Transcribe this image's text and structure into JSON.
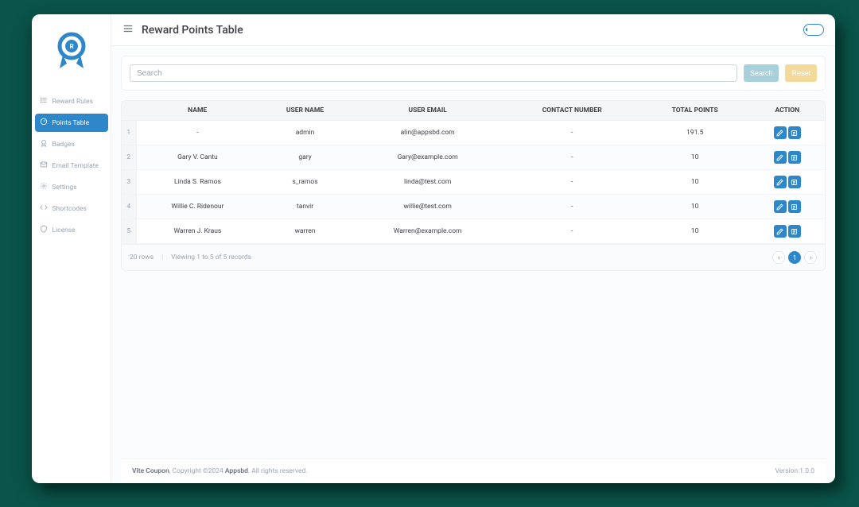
{
  "header": {
    "title": "Reward Points Table"
  },
  "sidebar": {
    "items": [
      {
        "label": "Reward Rules",
        "icon": "list-icon",
        "active": false
      },
      {
        "label": "Points Table",
        "icon": "gauge-icon",
        "active": true
      },
      {
        "label": "Badges",
        "icon": "badge-icon",
        "active": false
      },
      {
        "label": "Email Template",
        "icon": "mail-icon",
        "active": false
      },
      {
        "label": "Settings",
        "icon": "gear-icon",
        "active": false
      },
      {
        "label": "Shortcodes",
        "icon": "code-icon",
        "active": false
      },
      {
        "label": "License",
        "icon": "shield-icon",
        "active": false
      }
    ]
  },
  "search": {
    "placeholder": "Search",
    "search_label": "Search",
    "reset_label": "Reset"
  },
  "table": {
    "columns": [
      "NAME",
      "USER NAME",
      "USER EMAIL",
      "CONTACT NUMBER",
      "TOTAL POINTS",
      "ACTION"
    ],
    "rows": [
      {
        "num": "1",
        "name": "-",
        "user_name": "admin",
        "user_email": "alin@appsbd.com",
        "contact": "-",
        "points": "191.5"
      },
      {
        "num": "2",
        "name": "Gary V. Cantu",
        "user_name": "gary",
        "user_email": "Gary@example.com",
        "contact": "-",
        "points": "10"
      },
      {
        "num": "3",
        "name": "Linda S. Ramos",
        "user_name": "s_ramos",
        "user_email": "linda@test.com",
        "contact": "-",
        "points": "10"
      },
      {
        "num": "4",
        "name": "Willie C. Ridenour",
        "user_name": "tanvir",
        "user_email": "willie@test.com",
        "contact": "-",
        "points": "10"
      },
      {
        "num": "5",
        "name": "Warren J. Kraus",
        "user_name": "warren",
        "user_email": "Warren@example.com",
        "contact": "-",
        "points": "10"
      }
    ],
    "footer": {
      "rows_label": "20 rows",
      "viewing_label": "Viewing 1 to 5 of 5 records",
      "page": "1"
    }
  },
  "footer": {
    "product": "Vite Coupon",
    "copyright": ", Copyright ©2024 ",
    "company": "Appsbd",
    "rights": ". All rights reserved.",
    "version": "Version:1.0.0"
  }
}
